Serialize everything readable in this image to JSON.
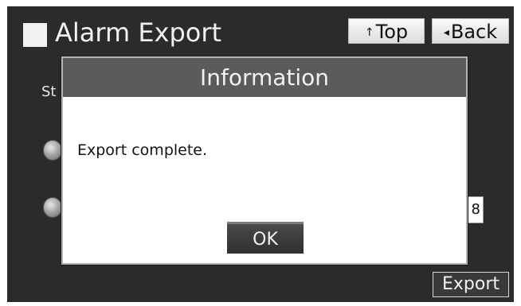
{
  "screen": {
    "title": "Alarm Export",
    "nav": {
      "top_arrow": "↑",
      "top_label": "Top",
      "back_arrow": "◂",
      "back_label": "Back"
    },
    "background": {
      "partial_label": "St",
      "field_value_partial": "8",
      "export_label": "Export"
    }
  },
  "dialog": {
    "title": "Information",
    "message": "Export complete.",
    "ok_label": "OK"
  },
  "colors": {
    "panel_bg": "#2b2b2b",
    "dialog_header_bg": "#5b5b5b",
    "dialog_bg": "#ffffff",
    "text_light": "#f2f2f2"
  },
  "icons": {
    "title_icon": "square-icon",
    "top_icon": "up-arrow-icon",
    "back_icon": "left-triangle-icon"
  }
}
